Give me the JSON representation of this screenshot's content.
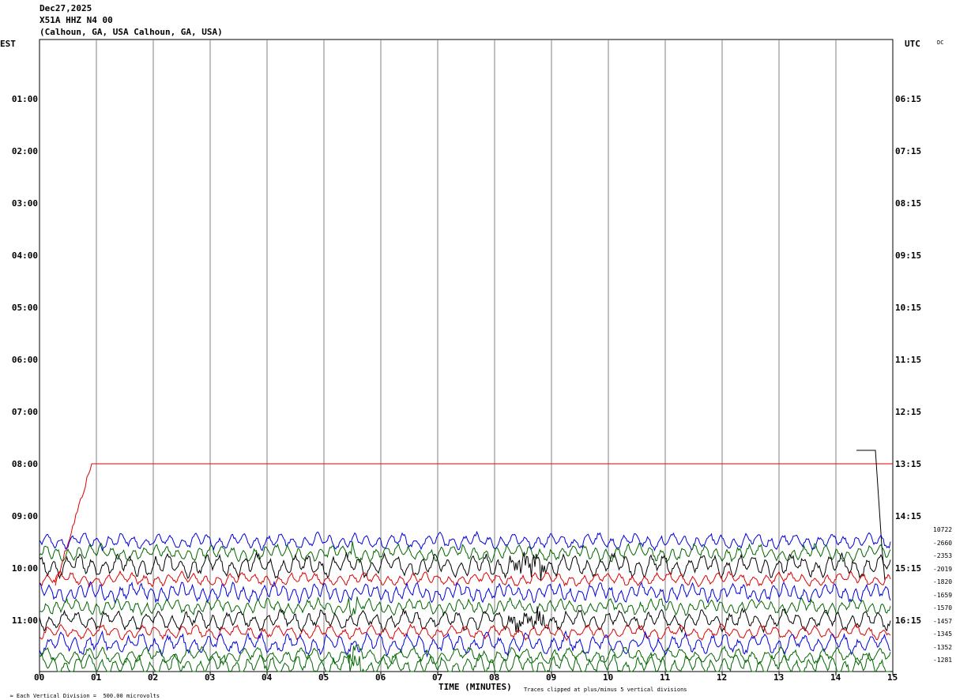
{
  "header": {
    "date": "Dec27,2025",
    "station": "X51A HHZ N4 00",
    "location": "(Calhoun, GA, USA Calhoun, GA, USA)"
  },
  "left_axis_label": "EST",
  "right_axis_label": "UTC",
  "corner_tag": "DC",
  "footer": {
    "division": "Each Vertical Division =  500.00 microvolts",
    "xlabel": "TIME (MINUTES)",
    "clip_note": "Traces clipped at plus/minus 5 vertical divisions"
  },
  "colors": {
    "black": "#000000",
    "red": "#dd0000",
    "blue": "#0000dd",
    "green": "#006600",
    "grid": "#808080"
  },
  "chart_data": {
    "type": "line",
    "title": "X51A HHZ N4 00",
    "xlabel": "TIME (MINUTES)",
    "x_ticks": [
      "00",
      "01",
      "02",
      "03",
      "04",
      "05",
      "06",
      "07",
      "08",
      "09",
      "10",
      "11",
      "12",
      "13",
      "14",
      "15"
    ],
    "xlim": [
      0,
      15
    ],
    "left_hour_labels": [
      "01:00",
      "02:00",
      "03:00",
      "04:00",
      "05:00",
      "06:00",
      "07:00",
      "08:00",
      "09:00",
      "10:00",
      "11:00"
    ],
    "right_hour_labels": [
      "06:15",
      "07:15",
      "08:15",
      "09:15",
      "10:15",
      "11:15",
      "12:15",
      "13:15",
      "14:15",
      "15:15",
      "16:15"
    ],
    "offset_labels": [
      "10722",
      "-2660",
      "-2353",
      "-2019",
      "-1820",
      "-1659",
      "-1570",
      "-1457",
      "-1345",
      "-1352",
      "-1281"
    ],
    "trace_colors": [
      "black",
      "red",
      "blue",
      "green"
    ],
    "traces_row_start_minutes": 15,
    "traces_rows": 11,
    "units": "microvolts",
    "division_microvolts": 500
  }
}
